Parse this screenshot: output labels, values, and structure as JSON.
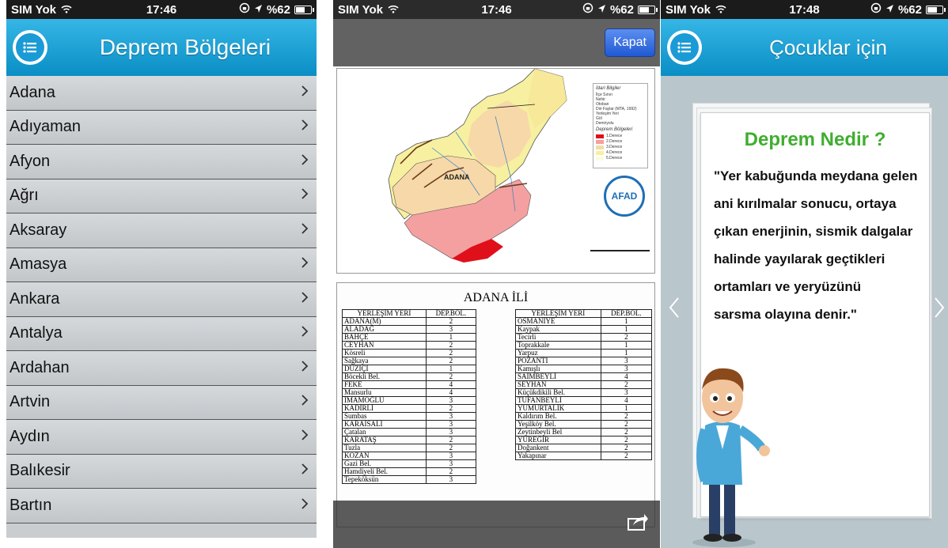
{
  "screen1": {
    "status": {
      "carrier": "SIM Yok",
      "time": "17:46",
      "battery": "%62",
      "battery_fill": 0.62
    },
    "title": "Deprem Bölgeleri",
    "cities": [
      "Adana",
      "Adıyaman",
      "Afyon",
      "Ağrı",
      "Aksaray",
      "Amasya",
      "Ankara",
      "Antalya",
      "Ardahan",
      "Artvin",
      "Aydın",
      "Balıkesir",
      "Bartın"
    ]
  },
  "screen2": {
    "status": {
      "carrier": "SIM Yok",
      "time": "17:46",
      "battery": "%62"
    },
    "close_label": "Kapat",
    "map": {
      "legend_title": "İdari Bilgiler",
      "legend_items": [
        "İlçe Sınırı",
        "Nehir",
        "Otoban",
        "Diri Faylar (MTA, 1992)",
        "Yerleşim Yeri",
        "Göl",
        "Demiryolu"
      ],
      "zones_title": "Deprem Bölgeleri",
      "zones": [
        {
          "label": "1.Derece",
          "color": "#e0101a"
        },
        {
          "label": "2.Derece",
          "color": "#f4a0a0"
        },
        {
          "label": "3.Derece",
          "color": "#f7d8a8"
        },
        {
          "label": "4.Derece",
          "color": "#f6f0a0"
        },
        {
          "label": "5.Derece",
          "color": "#fbfbe0"
        }
      ],
      "city_label": "ADANA",
      "logo": "AFAD"
    },
    "table": {
      "title": "ADANA İLİ",
      "col_place": "YERLEŞİM YERİ",
      "col_zone": "DEP.BÖL.",
      "left_rows": [
        [
          "ADANA(M)",
          "2"
        ],
        [
          "ALADAĞ",
          "3"
        ],
        [
          "BAHÇE",
          "1"
        ],
        [
          "CEYHAN",
          "2"
        ],
        [
          "Kösreli",
          "2"
        ],
        [
          "Sağkaya",
          "2"
        ],
        [
          "DÜZİÇİ",
          "1"
        ],
        [
          "Böcekli Bel.",
          "2"
        ],
        [
          "FEKE",
          "4"
        ],
        [
          "Mansurlu",
          "4"
        ],
        [
          "İMAMOĞLU",
          "3"
        ],
        [
          "KADİRLİ",
          "2"
        ],
        [
          "Sumbas",
          "3"
        ],
        [
          "KARAİSALI",
          "3"
        ],
        [
          "Çatalan",
          "3"
        ],
        [
          "KARATAŞ",
          "2"
        ],
        [
          "Tuzla",
          "2"
        ],
        [
          "KOZAN",
          "3"
        ],
        [
          "Gazi Bel.",
          "3"
        ],
        [
          "Hamdiyeli Bel.",
          "2"
        ],
        [
          "Tepeköksün",
          "3"
        ]
      ],
      "right_rows": [
        [
          "OSMANİYE",
          "1"
        ],
        [
          "Kaypak",
          "1"
        ],
        [
          "Tecirli",
          "2"
        ],
        [
          "Toprakkale",
          "1"
        ],
        [
          "Yarpuz",
          "1"
        ],
        [
          "POZANTI",
          "3"
        ],
        [
          "Kamışlı",
          "3"
        ],
        [
          "SAİMBEYLİ",
          "4"
        ],
        [
          "SEYHAN",
          "2"
        ],
        [
          "Küçükdikili Bel.",
          "3"
        ],
        [
          "TUFANBEYLİ",
          "4"
        ],
        [
          "YUMURTALIK",
          "1"
        ],
        [
          "Kaldırım Bel.",
          "2"
        ],
        [
          "Yeşilköy Bel.",
          "2"
        ],
        [
          "Zeytinbeyli Bel",
          "2"
        ],
        [
          "YÜREĞİR",
          "2"
        ],
        [
          "Doğankent",
          "2"
        ],
        [
          "Yakapınar",
          "2"
        ]
      ]
    }
  },
  "screen3": {
    "status": {
      "carrier": "SIM Yok",
      "time": "17:48",
      "battery": "%62"
    },
    "title": "Çocuklar için",
    "card_title": "Deprem Nedir ?",
    "card_lines": [
      "\"Yer kabuğunda meydana gelen",
      "ani kırılmalar sonucu, ortaya",
      "çıkan enerjinin, sismik dalgalar",
      "halinde yayılarak geçtikleri",
      "ortamları ve yeryüzünü",
      "sarsma olayına denir.\""
    ]
  }
}
